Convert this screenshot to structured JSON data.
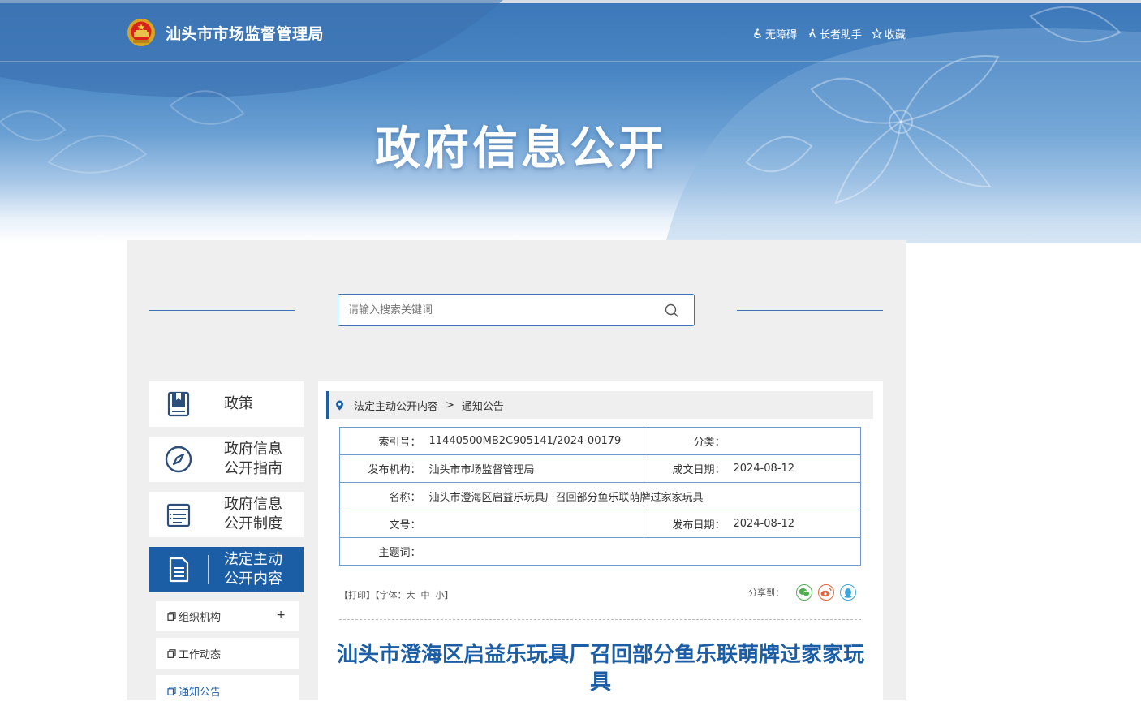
{
  "header": {
    "site_name": "汕头市市场监督管理局",
    "links": [
      {
        "label": "无障碍",
        "icon": "wheelchair-icon"
      },
      {
        "label": "长者助手",
        "icon": "elder-icon"
      },
      {
        "label": "收藏",
        "icon": "star-icon"
      }
    ],
    "banner_title": "政府信息公开"
  },
  "search": {
    "placeholder": "请输入搜索关键词"
  },
  "sidebar": {
    "items": [
      {
        "label": "政策",
        "icon": "policy-book-icon"
      },
      {
        "label": "政府信息\n公开指南",
        "icon": "compass-icon"
      },
      {
        "label": "政府信息\n公开制度",
        "icon": "document-list-icon"
      },
      {
        "label": "法定主动\n公开内容",
        "icon": "document-icon"
      }
    ],
    "sub_items": [
      {
        "label": "组织机构",
        "expand": "+"
      },
      {
        "label": "工作动态",
        "expand": ""
      },
      {
        "label": "通知公告",
        "expand": ""
      }
    ]
  },
  "breadcrumb": {
    "items": [
      "法定主动公开内容",
      "通知公告"
    ],
    "separator": ">"
  },
  "meta": {
    "index_label": "索引号：",
    "index_value": "11440500MB2C905141/2024-00179",
    "category_label": "分类：",
    "category_value": "",
    "publisher_label": "发布机构：",
    "publisher_value": "汕头市市场监督管理局",
    "created_label": "成文日期：",
    "created_value": "2024-08-12",
    "name_label": "名称：",
    "name_value": "汕头市澄海区启益乐玩具厂召回部分鱼乐联萌牌过家家玩具",
    "docno_label": "文号：",
    "docno_value": "",
    "published_label": "发布日期：",
    "published_value": "2024-08-12",
    "keywords_label": "主题词：",
    "keywords_value": ""
  },
  "tools": {
    "print": "【打印】",
    "font_prefix": "【字体：",
    "font_large": "大",
    "font_medium": "中",
    "font_small": "小",
    "font_suffix": "】",
    "share_label": "分享到：",
    "share_icons": [
      "wechat-icon",
      "weibo-icon",
      "qq-icon"
    ],
    "colors": {
      "wechat": "#4caf50",
      "weibo": "#e8613c",
      "qq": "#3ea7d9"
    }
  },
  "article": {
    "title": "汕头市澄海区启益乐玩具厂召回部分鱼乐联萌牌过家家玩具"
  },
  "colors": {
    "primary": "#1b5ea6",
    "panel_bg": "#efefef",
    "border": "#6e9bcf"
  }
}
